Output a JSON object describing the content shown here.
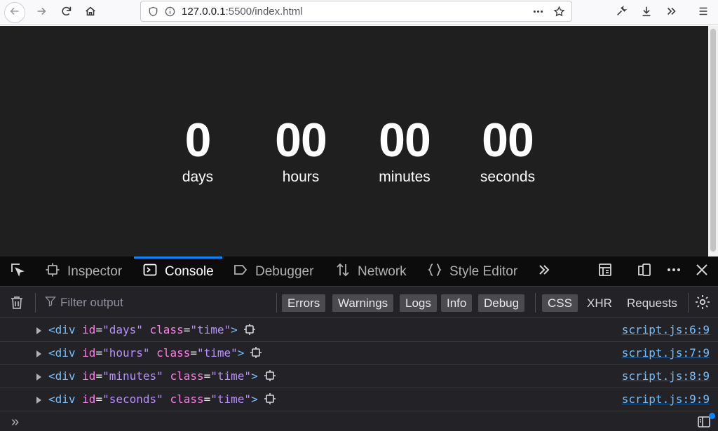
{
  "browser": {
    "url_prefix": "127.0.0.1",
    "url_suffix": ":5500/index.html",
    "icons": [
      "back-arrow-icon",
      "forward-arrow-icon",
      "reload-icon",
      "home-icon",
      "shield-icon",
      "info-icon",
      "more-dots-icon",
      "star-icon",
      "wrench-icon",
      "download-icon",
      "overflow-chevrons-icon",
      "hamburger-menu-icon"
    ]
  },
  "countdown": {
    "units": [
      {
        "value": "0",
        "label": "days"
      },
      {
        "value": "00",
        "label": "hours"
      },
      {
        "value": "00",
        "label": "minutes"
      },
      {
        "value": "00",
        "label": "seconds"
      }
    ]
  },
  "devtools": {
    "tabs": [
      {
        "label": "Inspector",
        "icon": "inspector-icon"
      },
      {
        "label": "Console",
        "icon": "console-icon"
      },
      {
        "label": "Debugger",
        "icon": "debugger-icon"
      },
      {
        "label": "Network",
        "icon": "network-icon"
      },
      {
        "label": "Style Editor",
        "icon": "style-editor-icon"
      }
    ],
    "active_tab": "Console",
    "filter_placeholder": "Filter output",
    "levels": [
      "Errors",
      "Warnings",
      "Logs",
      "Info",
      "Debug"
    ],
    "css_label": "CSS",
    "xhr_label": "XHR",
    "requests_label": "Requests",
    "logs": [
      {
        "id": "days",
        "class": "time",
        "source": "script.js:6:9"
      },
      {
        "id": "hours",
        "class": "time",
        "source": "script.js:7:9"
      },
      {
        "id": "minutes",
        "class": "time",
        "source": "script.js:8:9"
      },
      {
        "id": "seconds",
        "class": "time",
        "source": "script.js:9:9"
      }
    ],
    "prompt": "»",
    "accent_color": "#0a84ff"
  }
}
